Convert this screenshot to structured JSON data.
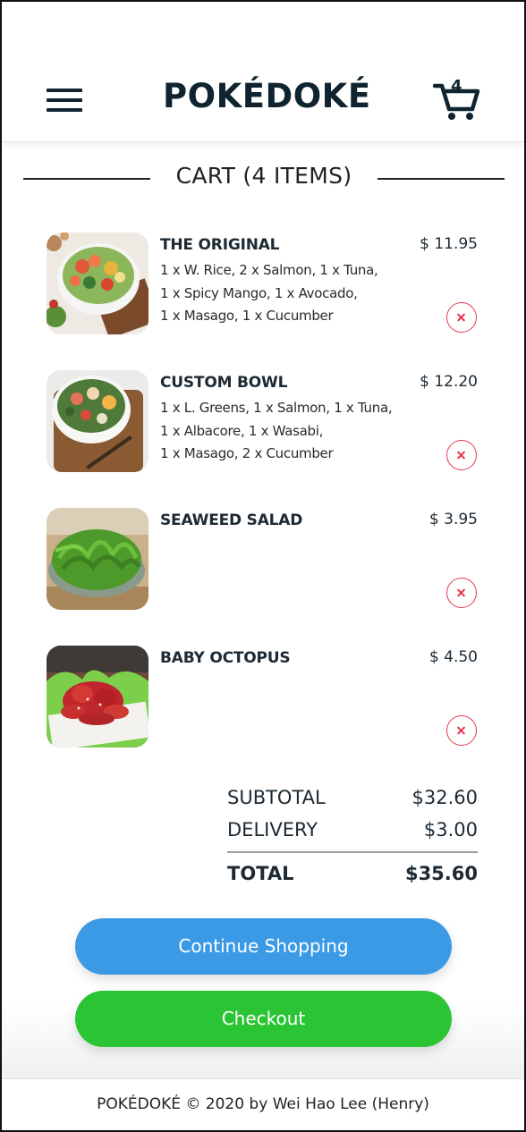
{
  "header": {
    "logo": "POKÉDOKÉ",
    "cart_count": "4",
    "menu_icon": "hamburger-menu-icon",
    "cart_icon": "shopping-cart-icon"
  },
  "cart": {
    "title": "CART (4 ITEMS)",
    "items": [
      {
        "name": "THE ORIGINAL",
        "price": "$ 11.95",
        "desc": [
          "1 x W. Rice, 2 x Salmon, 1 x Tuna,",
          "1 x Spicy Mango, 1 x Avocado,",
          "1 x Masago, 1 x Cucumber"
        ]
      },
      {
        "name": "CUSTOM BOWL",
        "price": "$ 12.20",
        "desc": [
          "1 x L. Greens, 1 x Salmon, 1 x Tuna,",
          "1 x Albacore, 1 x Wasabi,",
          "1 x Masago, 2 x Cucumber"
        ]
      },
      {
        "name": "SEAWEED SALAD",
        "price": "$ 3.95",
        "desc": []
      },
      {
        "name": "BABY OCTOPUS",
        "price": "$ 4.50",
        "desc": []
      }
    ]
  },
  "summary": {
    "subtotal_label": "SUBTOTAL",
    "subtotal": "$32.60",
    "delivery_label": "DELIVERY",
    "delivery": "$3.00",
    "total_label": "TOTAL",
    "total": "$35.60"
  },
  "buttons": {
    "continue": "Continue Shopping",
    "checkout": "Checkout"
  },
  "footer": {
    "text": "POKÉDOKÉ © 2020 by Wei Hao Lee (Henry)"
  },
  "colors": {
    "continue_button": "#3b9ae5",
    "checkout_button": "#2ac434",
    "remove_icon": "#e23a4e",
    "brand_text": "#0f2430"
  }
}
